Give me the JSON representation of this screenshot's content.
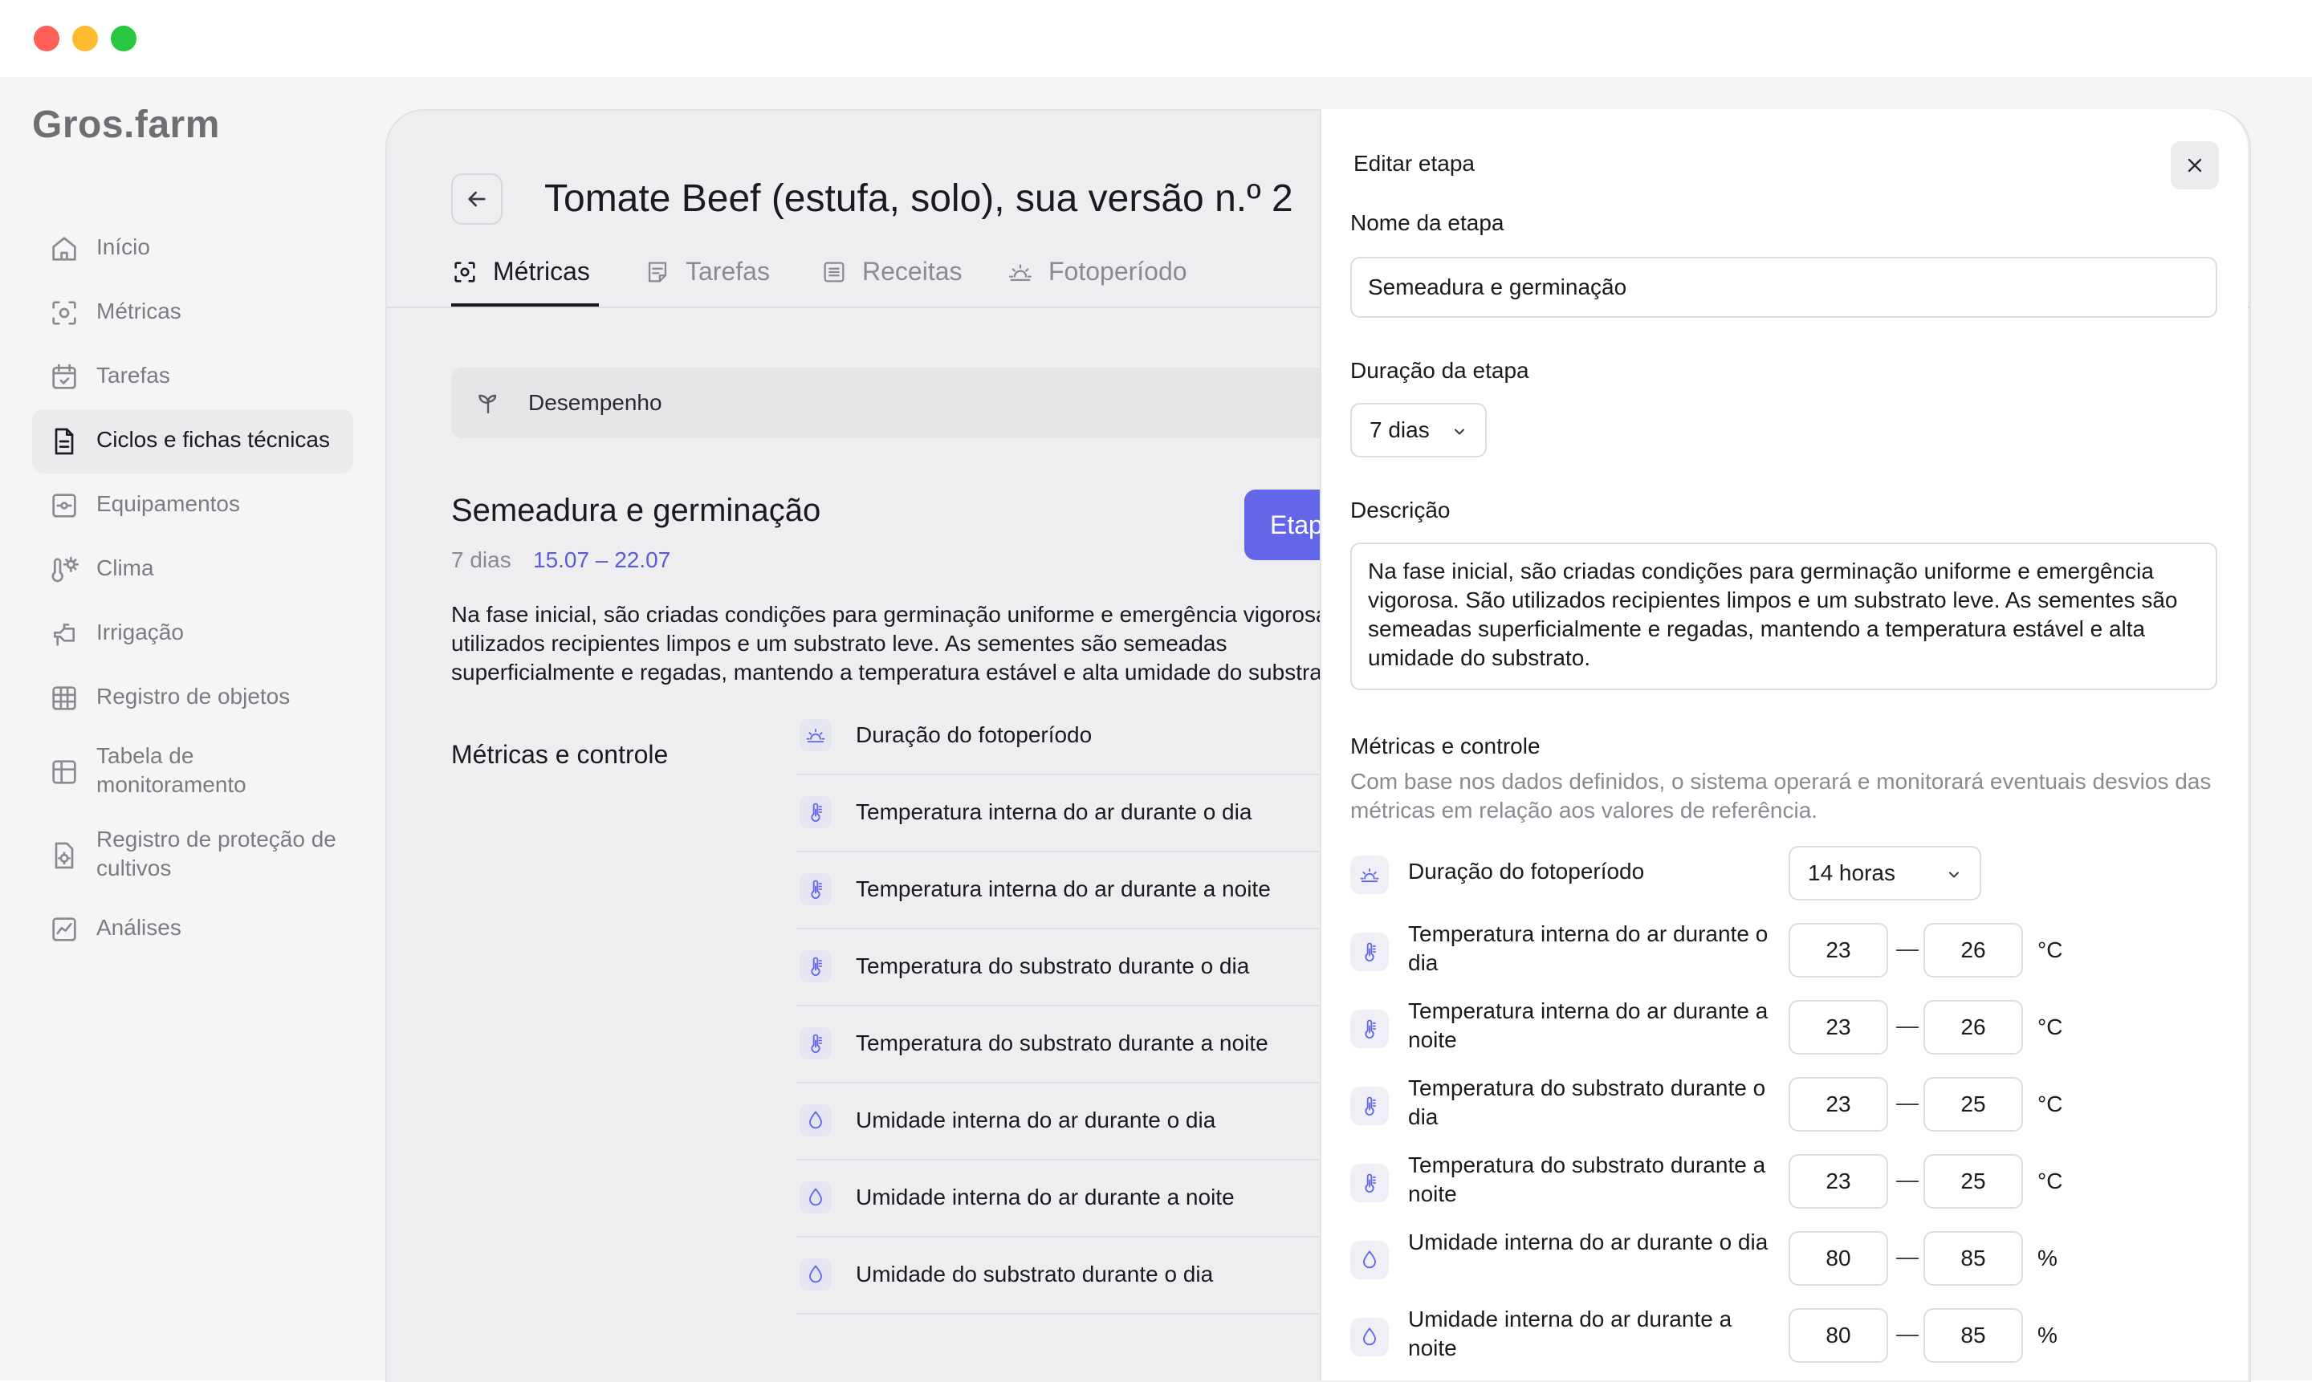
{
  "window": {
    "controls": [
      "close",
      "minimize",
      "maximize"
    ]
  },
  "colors": {
    "accent": "#6466e9",
    "accent_text": "#5b5bd6",
    "close": "#ff5f57",
    "minimize": "#febc2e",
    "maximize": "#28c840"
  },
  "app": {
    "logo": "Gros.farm"
  },
  "sidebar": {
    "items": [
      {
        "label": "Início",
        "icon": "home-icon"
      },
      {
        "label": "Métricas",
        "icon": "metrics-icon"
      },
      {
        "label": "Tarefas",
        "icon": "calendar-icon"
      },
      {
        "label": "Ciclos e fichas técnicas",
        "icon": "document-icon",
        "active": true
      },
      {
        "label": "Equipamentos",
        "icon": "equipment-icon"
      },
      {
        "label": "Clima",
        "icon": "thermometer-sun-icon"
      },
      {
        "label": "Irrigação",
        "icon": "irrigation-icon"
      },
      {
        "label": "Registro de objetos",
        "icon": "grid-icon"
      },
      {
        "label": "Tabela de monitoramento",
        "icon": "table-icon"
      },
      {
        "label": "Registro de proteção de cultivos",
        "icon": "protection-icon"
      },
      {
        "label": "Análises",
        "icon": "chart-icon"
      }
    ]
  },
  "main": {
    "title": "Tomate Beef (estufa, solo), sua versão n.º 2",
    "tabs": [
      {
        "label": "Métricas",
        "icon": "metrics-icon",
        "active": true
      },
      {
        "label": "Tarefas",
        "icon": "tasks-icon"
      },
      {
        "label": "Receitas",
        "icon": "recipes-icon"
      },
      {
        "label": "Fotoperíodo",
        "icon": "sun-icon"
      }
    ],
    "performance_label": "Desempenho",
    "stage": {
      "title": "Semeadura e germinação",
      "days": "7 dias",
      "dates": "15.07 – 22.07",
      "button_label": "Etapa",
      "description": "Na fase inicial, são criadas condições para germinação uniforme e emergência vigorosa. São utilizados recipientes limpos e um substrato leve. As sementes são semeadas superficialmente e regadas, mantendo a temperatura estável e alta umidade do substrato."
    },
    "metrics_title": "Métricas e controle",
    "metrics": [
      {
        "label": "Duração do fotoperíodo",
        "icon": "sun-icon"
      },
      {
        "label": "Temperatura interna do ar durante o dia",
        "icon": "thermometer-icon"
      },
      {
        "label": "Temperatura interna do ar durante a noite",
        "icon": "thermometer-icon"
      },
      {
        "label": "Temperatura do substrato durante o dia",
        "icon": "thermometer-icon"
      },
      {
        "label": "Temperatura do substrato durante a noite",
        "icon": "thermometer-icon"
      },
      {
        "label": "Umidade interna do ar durante o dia",
        "icon": "drop-icon"
      },
      {
        "label": "Umidade interna do ar durante a noite",
        "icon": "drop-icon"
      },
      {
        "label": "Umidade do substrato durante o dia",
        "icon": "drop-icon"
      }
    ]
  },
  "drawer": {
    "title": "Editar etapa",
    "name_label": "Nome da etapa",
    "name_value": "Semeadura e germinação",
    "duration_label": "Duração da etapa",
    "duration_value": "7 dias",
    "description_label": "Descrição",
    "description_value": "Na fase inicial, são criadas condições para germinação uniforme e emergência vigorosa. São utilizados recipientes limpos e um substrato leve. As sementes são semeadas superficialmente e regadas, mantendo a temperatura estável e alta umidade do substrato.",
    "metrics_title": "Métricas e controle",
    "metrics_subtitle": "Com base nos dados definidos, o sistema operará e monitorará eventuais desvios das métricas em relação aos valores de referência.",
    "photoperiod": {
      "label": "Duração do fotoperíodo",
      "value": "14 horas"
    },
    "params": [
      {
        "label": "Temperatura interna do ar durante o dia",
        "min": "23",
        "max": "26",
        "unit": "°C",
        "icon": "thermometer-icon"
      },
      {
        "label": "Temperatura interna do ar durante a noite",
        "min": "23",
        "max": "26",
        "unit": "°C",
        "icon": "thermometer-icon"
      },
      {
        "label": "Temperatura do substrato durante o dia",
        "min": "23",
        "max": "25",
        "unit": "°C",
        "icon": "thermometer-icon"
      },
      {
        "label": "Temperatura do substrato durante a noite",
        "min": "23",
        "max": "25",
        "unit": "°C",
        "icon": "thermometer-icon"
      },
      {
        "label": "Umidade interna do ar durante o dia",
        "min": "80",
        "max": "85",
        "unit": "%",
        "icon": "drop-icon"
      },
      {
        "label": "Umidade interna do ar durante a noite",
        "min": "80",
        "max": "85",
        "unit": "%",
        "icon": "drop-icon"
      }
    ],
    "range_separator": "—"
  }
}
